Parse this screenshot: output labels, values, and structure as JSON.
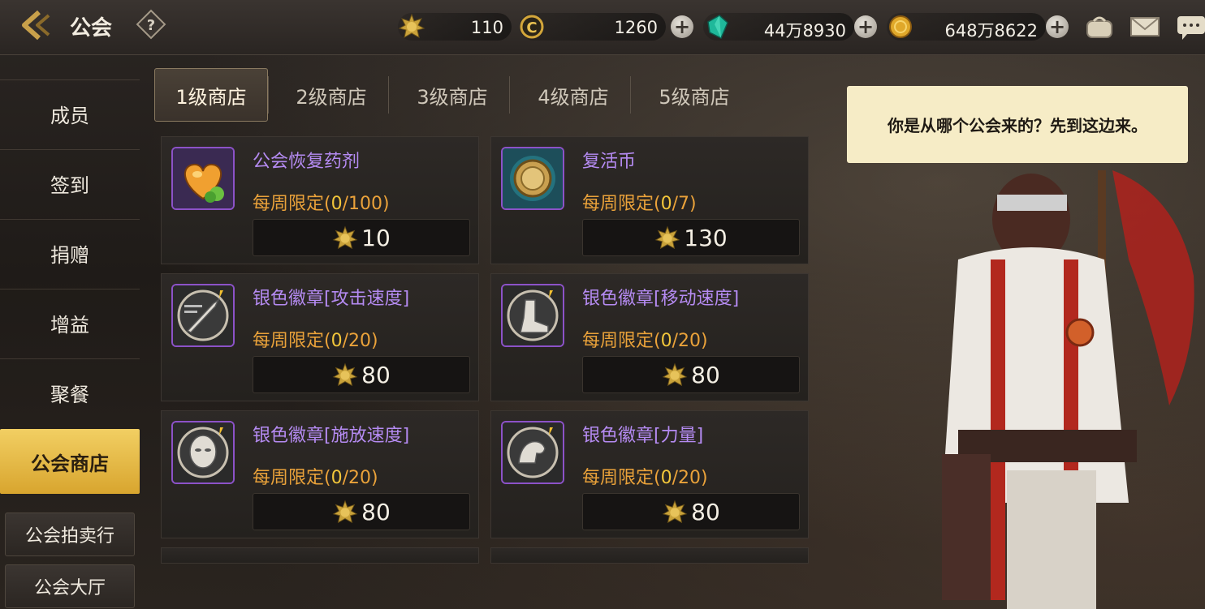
{
  "header": {
    "title": "公会"
  },
  "resources": [
    {
      "name": "guild-coin",
      "value": "110",
      "has_plus": false
    },
    {
      "name": "gold-c-coin",
      "value": "1260",
      "has_plus": true
    },
    {
      "name": "gem",
      "value": "44万8930",
      "has_plus": true
    },
    {
      "name": "gold-coin",
      "value": "648万8622",
      "has_plus": true
    }
  ],
  "sidebar": {
    "items": [
      {
        "label": "成员"
      },
      {
        "label": "签到"
      },
      {
        "label": "捐赠"
      },
      {
        "label": "增益"
      },
      {
        "label": "聚餐"
      },
      {
        "label": "公会商店",
        "active": true
      }
    ],
    "sub_items": [
      {
        "label": "公会拍卖行"
      },
      {
        "label": "公会大厅"
      }
    ]
  },
  "tabs": [
    {
      "label": "1级商店",
      "active": true
    },
    {
      "label": "2级商店"
    },
    {
      "label": "3级商店"
    },
    {
      "label": "4级商店"
    },
    {
      "label": "5级商店"
    }
  ],
  "shop_items": [
    {
      "name": "公会恢复药剂",
      "limit_prefix": "每周限定(",
      "count": "0",
      "limit_suffix": "/100)",
      "price": "10",
      "icon": "heart-potion-icon"
    },
    {
      "name": "复活币",
      "limit_prefix": "每周限定(",
      "count": "0",
      "limit_suffix": "/7)",
      "price": "130",
      "icon": "revive-coin-icon"
    },
    {
      "name": "银色徽章[攻击速度]",
      "limit_prefix": "每周限定(",
      "count": "0",
      "limit_suffix": "/20)",
      "price": "80",
      "icon": "sword-badge-icon"
    },
    {
      "name": "银色徽章[移动速度]",
      "limit_prefix": "每周限定(",
      "count": "0",
      "limit_suffix": "/20)",
      "price": "80",
      "icon": "boot-badge-icon"
    },
    {
      "name": "银色徽章[施放速度]",
      "limit_prefix": "每周限定(",
      "count": "0",
      "limit_suffix": "/20)",
      "price": "80",
      "icon": "head-badge-icon"
    },
    {
      "name": "银色徽章[力量]",
      "limit_prefix": "每周限定(",
      "count": "0",
      "limit_suffix": "/20)",
      "price": "80",
      "icon": "arm-badge-icon"
    }
  ],
  "npc": {
    "speech": "你是从哪个公会来的？先到这边来。"
  },
  "colors": {
    "item_name": "#b58bf2",
    "limit_text": "#eaa23a",
    "active_sidebar": "#e6b84a",
    "bubble_bg": "#f6ecc6"
  }
}
